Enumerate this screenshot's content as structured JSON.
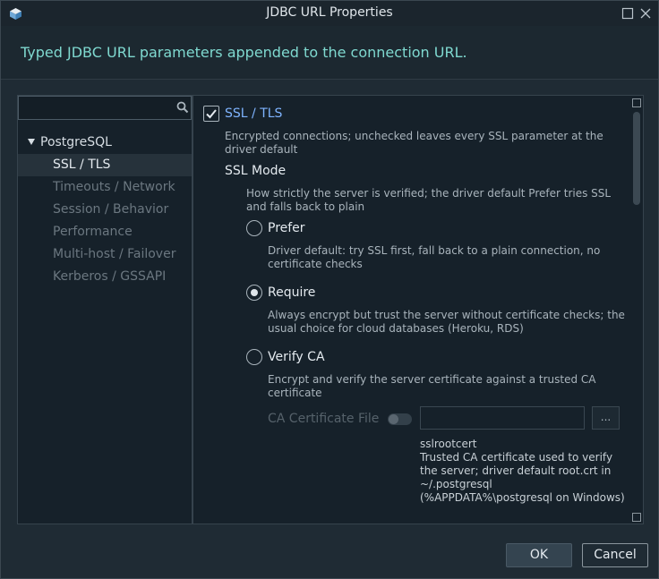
{
  "window": {
    "title": "JDBC URL Properties",
    "app_icon": "cube-app-icon",
    "maximize_icon": "maximize-icon",
    "close_icon": "close-icon"
  },
  "header": {
    "text": "Typed JDBC URL parameters appended to the connection URL."
  },
  "search": {
    "value": "",
    "placeholder": "",
    "icon": "search-icon"
  },
  "tree": {
    "root": "PostgreSQL",
    "items": [
      {
        "label": "SSL / TLS",
        "selected": true
      },
      {
        "label": "Timeouts / Network",
        "selected": false
      },
      {
        "label": "Session / Behavior",
        "selected": false
      },
      {
        "label": "Performance",
        "selected": false
      },
      {
        "label": "Multi-host / Failover",
        "selected": false
      },
      {
        "label": "Kerberos / GSSAPI",
        "selected": false
      }
    ]
  },
  "ssl": {
    "enabled": true,
    "label": "SSL / TLS",
    "description": "Encrypted connections; unchecked leaves every SSL parameter at the driver default",
    "mode_label": "SSL Mode",
    "mode_description": "How strictly the server is verified; the driver default Prefer tries SSL and falls back to plain",
    "options": [
      {
        "label": "Prefer",
        "description": "Driver default: try SSL first, fall back to a plain connection, no certificate checks",
        "checked": false
      },
      {
        "label": "Require",
        "description": "Always encrypt but trust the server without certificate checks; the usual choice for cloud databases (Heroku, RDS)",
        "checked": true
      },
      {
        "label": "Verify CA",
        "description": "Encrypt and verify the server certificate against a trusted CA certificate",
        "checked": false
      }
    ],
    "ca_file": {
      "label": "CA Certificate File",
      "enabled": false,
      "value": "",
      "browse_label": "...",
      "param_name": "sslrootcert",
      "param_description": "Trusted CA certificate used to verify the server; driver default root.crt in ~/.postgresql (%APPDATA%\\postgresql on Windows)"
    }
  },
  "buttons": {
    "ok": "OK",
    "cancel": "Cancel"
  },
  "colors": {
    "accent_link": "#7fb4ff",
    "header_text": "#7fd9d0",
    "background": "#1f2b34",
    "panel": "#16212a"
  }
}
